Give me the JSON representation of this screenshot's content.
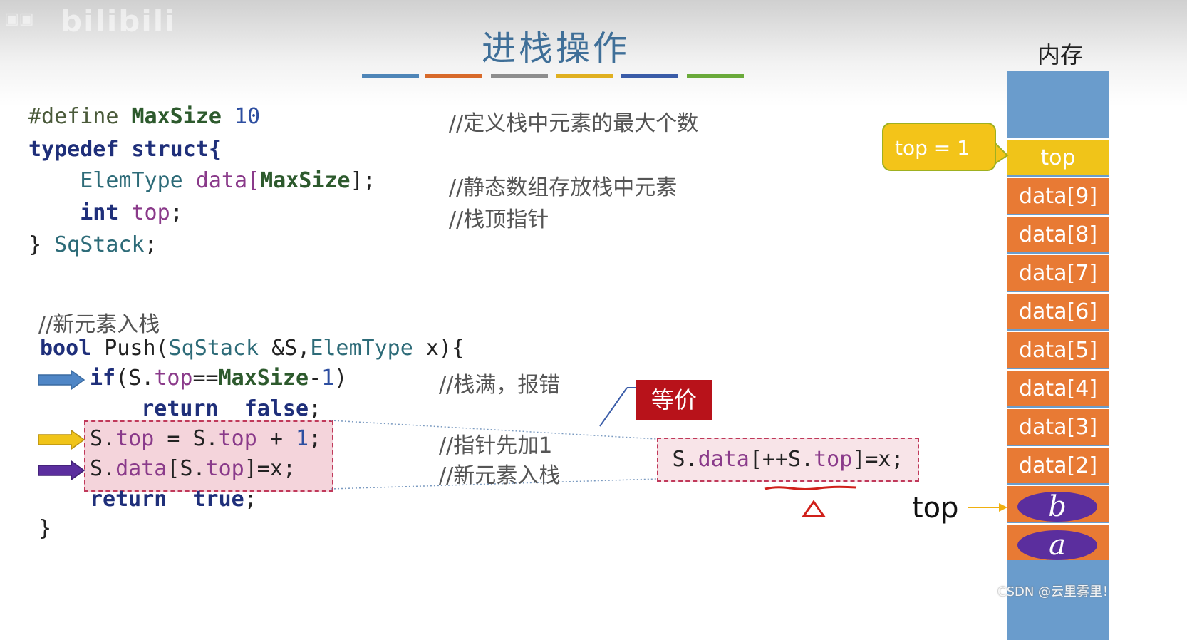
{
  "watermark": {
    "text": "bilibili"
  },
  "title": "进栈操作",
  "title_bar_colors": [
    "#4f86b8",
    "#d86a2a",
    "#8e8e8e",
    "#e0b020",
    "#3a5ca8",
    "#6aaa3a"
  ],
  "struct_code": {
    "line1": {
      "directive": "#define",
      "macro": "MaxSize",
      "value": "10",
      "comment": "//定义栈中元素的最大个数"
    },
    "line2": {
      "kw1": "typedef",
      "kw2": "struct",
      "brace": "{"
    },
    "line3": {
      "type": "ElemType",
      "rest1": "data[",
      "macro": "MaxSize",
      "rest2": "];",
      "comment": "//静态数组存放栈中元素"
    },
    "line4": {
      "kw": "int",
      "var": "top",
      "rest": ";",
      "comment": "//栈顶指针"
    },
    "line5": {
      "text": "} ",
      "name": "SqStack",
      "end": ";"
    }
  },
  "push_code": {
    "header_comment": "//新元素入栈",
    "signature": {
      "kw": "bool",
      "name": " Push(",
      "t1": "SqStack",
      "p1": " &S,",
      "t2": "ElemType",
      "p2": " x){"
    },
    "if_line": {
      "kw": "if",
      "p1": "(S.",
      "var": "top",
      "op": "==",
      "macro": "MaxSize",
      "minus": "-",
      "num": "1",
      "close": ")"
    },
    "if_comment": "//栈满，报错",
    "return_false": {
      "kw1": "return",
      "kw2": "false",
      "end": ";"
    },
    "inc_line": {
      "p1": "S.",
      "var1": "top",
      "p2": " = S.",
      "var2": "top",
      "p3": " + ",
      "num": "1",
      "end": ";"
    },
    "inc_comment": "//指针先加1",
    "assign_line": {
      "p1": "S.",
      "var1": "data",
      "p2": "[S.",
      "var2": "top",
      "p3": "]=x;"
    },
    "assign_comment": "//新元素入栈",
    "return_true": {
      "kw1": "return",
      "kw2": "true",
      "end": ";"
    },
    "close": "}"
  },
  "equivalent": {
    "badge": "等价",
    "code": {
      "p1": "S.",
      "var1": "data",
      "p2": "[++S.",
      "var2": "top",
      "p3": "]=x;"
    }
  },
  "memory": {
    "label": "内存",
    "top_cell": "top",
    "callout": "top = 1",
    "cells": [
      "data[9]",
      "data[8]",
      "data[7]",
      "data[6]",
      "data[5]",
      "data[4]",
      "data[3]",
      "data[2]"
    ],
    "ovals": [
      "b",
      "a"
    ],
    "pointer_label": "top"
  },
  "footer": "CSDN @云里雾里！",
  "colors": {
    "blue_arrow": "#4f86c6",
    "yellow_arrow": "#f0c419",
    "purple_arrow": "#5b2e9e",
    "highlight_border": "#c0395a",
    "badge": "#b8121a"
  }
}
